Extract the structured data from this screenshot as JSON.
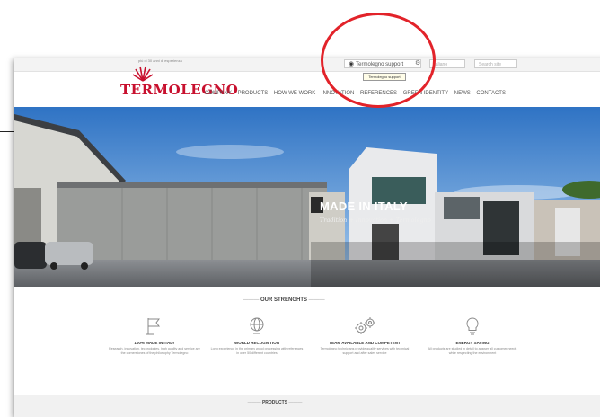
{
  "header": {
    "support_label": "Termolegno support",
    "tooltip": "Termolegno support",
    "lang_placeholder": "Italiano",
    "search_placeholder": "Search site",
    "logo_tagline": "più di 30 anni di esperienza",
    "logo_text": "TERMOLEGNO"
  },
  "nav": {
    "items": [
      "COMPANY",
      "PRODUCTS",
      "HOW WE WORK",
      "INNOVATION",
      "REFERENCES",
      "GREEN IDENTITY",
      "NEWS",
      "CONTACTS"
    ]
  },
  "hero": {
    "title": "MADE IN ITALY",
    "subtitle": "Tradition + Innovation + Termolegno"
  },
  "strengths": {
    "title": "OUR STRENGHTS",
    "items": [
      {
        "icon": "flag-icon",
        "title": "100% MADE IN ITALY",
        "text": "Research, innovation, technologies, high quality and service are the cornerstones of the philosophy Termolegno"
      },
      {
        "icon": "globe-icon",
        "title": "WORLD RECOGNITION",
        "text": "Long experience in the primary wood processing with references in over 50 different countries"
      },
      {
        "icon": "gears-icon",
        "title": "TEAM AVAILABLE AND COMPETENT",
        "text": "Termolegno technicians provide quality services with technical support and after sales service"
      },
      {
        "icon": "bulb-icon",
        "title": "ENERGY SAVING",
        "text": "All products are studied in detail to answer all customer needs while respecting the environment"
      }
    ]
  },
  "products": {
    "title": "PRODUCTS"
  },
  "colors": {
    "brand_red": "#c8102e",
    "highlight": "#e2232a"
  }
}
